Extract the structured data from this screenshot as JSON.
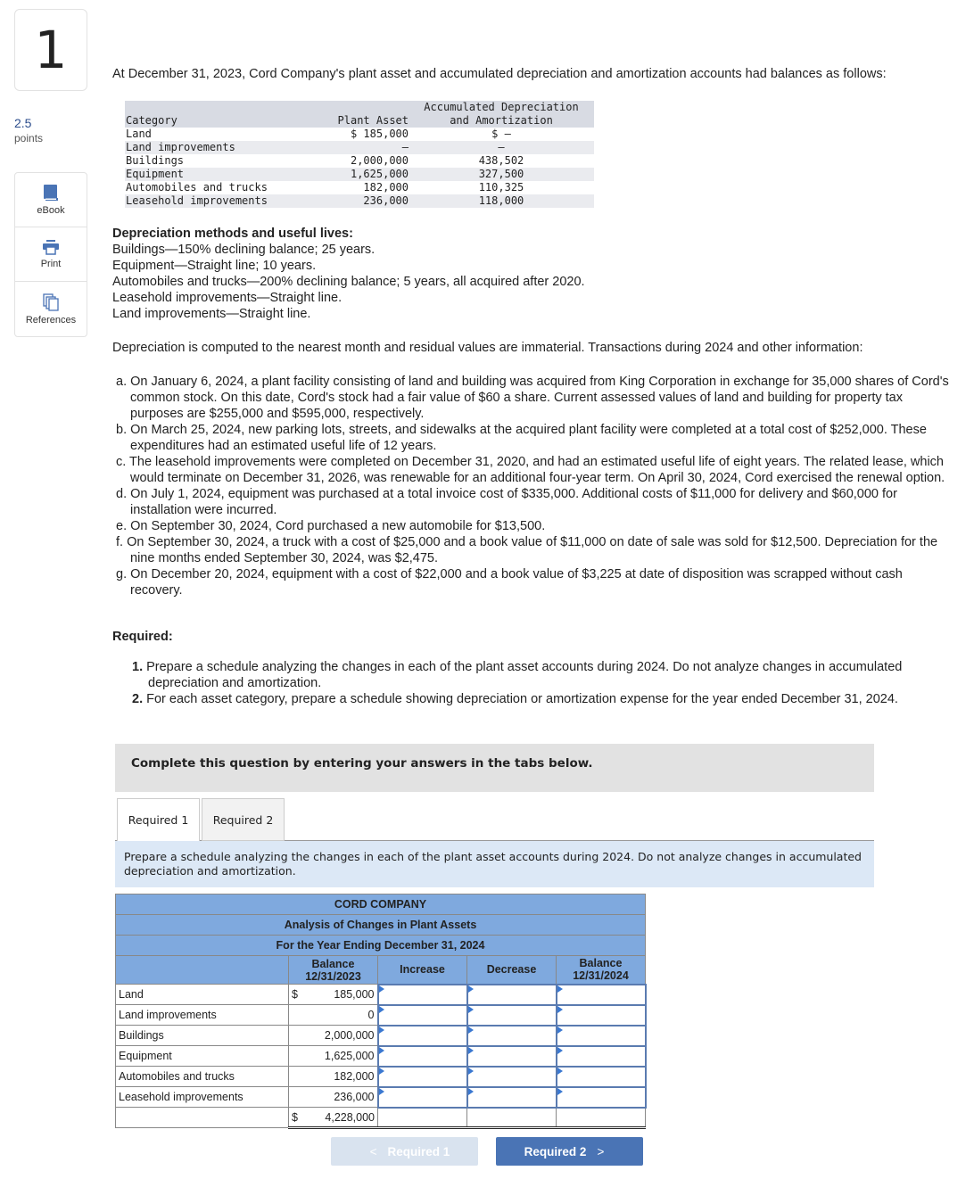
{
  "question_number": "1",
  "points": {
    "value": "2.5",
    "label": "points"
  },
  "tools": [
    {
      "icon": "ebook-icon",
      "label": "eBook"
    },
    {
      "icon": "print-icon",
      "label": "Print"
    },
    {
      "icon": "references-icon",
      "label": "References"
    }
  ],
  "intro": "At December 31, 2023, Cord Company's plant asset and accumulated depreciation and amortization accounts had balances as follows:",
  "balances": {
    "headers": {
      "category": "Category",
      "plant_asset": "Plant Asset",
      "accum_line1": "Accumulated Depreciation",
      "accum_line2": "and Amortization"
    },
    "rows": [
      {
        "category": "Land",
        "plant_asset": "$ 185,000",
        "accum": "$ —"
      },
      {
        "category": "Land improvements",
        "plant_asset": "—",
        "accum": "—"
      },
      {
        "category": "Buildings",
        "plant_asset": "2,000,000",
        "accum": "438,502"
      },
      {
        "category": "Equipment",
        "plant_asset": "1,625,000",
        "accum": "327,500"
      },
      {
        "category": "Automobiles and trucks",
        "plant_asset": "182,000",
        "accum": "110,325"
      },
      {
        "category": "Leasehold improvements",
        "plant_asset": "236,000",
        "accum": "118,000"
      }
    ]
  },
  "methods": {
    "heading": "Depreciation methods and useful lives:",
    "lines": [
      "Buildings—150% declining balance; 25 years.",
      "Equipment—Straight line; 10 years.",
      "Automobiles and trucks—200% declining balance; 5 years, all acquired after 2020.",
      "Leasehold improvements—Straight line.",
      "Land improvements—Straight line."
    ]
  },
  "compute_note": "Depreciation is computed to the nearest month and residual values are immaterial. Transactions during 2024 and other information:",
  "transactions": [
    "a. On January 6, 2024, a plant facility consisting of land and building was acquired from King Corporation in exchange for 35,000 shares of Cord's common stock. On this date, Cord's stock had a fair value of $60 a share. Current assessed values of land and building for property tax purposes are $255,000 and $595,000, respectively.",
    "b. On March 25, 2024, new parking lots, streets, and sidewalks at the acquired plant facility were completed at a total cost of $252,000. These expenditures had an estimated useful life of 12 years.",
    "c. The leasehold improvements were completed on December 31, 2020, and had an estimated useful life of eight years. The related lease, which would terminate on December 31, 2026, was renewable for an additional four-year term. On April 30, 2024, Cord exercised the renewal option.",
    "d. On July 1, 2024, equipment was purchased at a total invoice cost of $335,000. Additional costs of $11,000 for delivery and $60,000 for installation were incurred.",
    "e. On September 30, 2024, Cord purchased a new automobile for $13,500.",
    "f. On September 30, 2024, a truck with a cost of $25,000 and a book value of $11,000 on date of sale was sold for $12,500. Depreciation for the nine months ended September 30, 2024, was $2,475.",
    "g. On December 20, 2024, equipment with a cost of $22,000 and a book value of $3,225 at date of disposition was scrapped without cash recovery."
  ],
  "required": {
    "heading": "Required:",
    "items": [
      {
        "num": "1.",
        "text": " Prepare a schedule analyzing the changes in each of the plant asset accounts during 2024. Do not analyze changes in accumulated depreciation and amortization."
      },
      {
        "num": "2.",
        "text": " For each asset category, prepare a schedule showing depreciation or amortization expense for the year ended December 31, 2024."
      }
    ]
  },
  "complete_banner": "Complete this question by entering your answers in the tabs below.",
  "tabs": [
    {
      "label": "Required 1",
      "active": true
    },
    {
      "label": "Required 2",
      "active": false
    }
  ],
  "instruction": "Prepare a schedule analyzing the changes in each of the plant asset accounts during 2024. Do not analyze changes in accumulated depreciation and amortization.",
  "schedule": {
    "title1": "CORD COMPANY",
    "title2": "Analysis of Changes in Plant Assets",
    "title3": "For the Year Ending December 31, 2024",
    "col_headers": {
      "balance_start_1": "Balance",
      "balance_start_2": "12/31/2023",
      "increase": "Increase",
      "decrease": "Decrease",
      "balance_end_1": "Balance",
      "balance_end_2": "12/31/2024"
    },
    "rows": [
      {
        "label": "Land",
        "currency": "$",
        "balance": "185,000",
        "increase": "",
        "decrease": "",
        "ending": ""
      },
      {
        "label": "Land improvements",
        "currency": "",
        "balance": "0",
        "increase": "",
        "decrease": "",
        "ending": ""
      },
      {
        "label": "Buildings",
        "currency": "",
        "balance": "2,000,000",
        "increase": "",
        "decrease": "",
        "ending": ""
      },
      {
        "label": "Equipment",
        "currency": "",
        "balance": "1,625,000",
        "increase": "",
        "decrease": "",
        "ending": ""
      },
      {
        "label": "Automobiles and trucks",
        "currency": "",
        "balance": "182,000",
        "increase": "",
        "decrease": "",
        "ending": ""
      },
      {
        "label": "Leasehold improvements",
        "currency": "",
        "balance": "236,000",
        "increase": "",
        "decrease": "",
        "ending": ""
      }
    ],
    "total": {
      "currency": "$",
      "balance": "4,228,000"
    }
  },
  "nav": {
    "prev_label": "Required 1",
    "next_label": "Required 2"
  }
}
